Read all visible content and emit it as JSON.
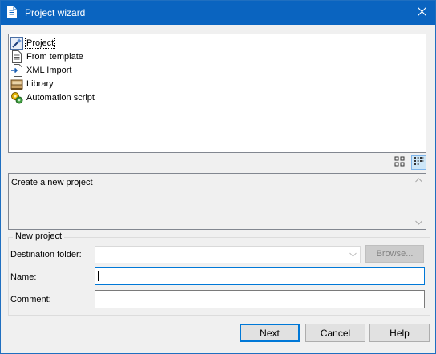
{
  "window": {
    "title": "Project wizard"
  },
  "templates": [
    {
      "label": "Project",
      "icon": "project-wand-icon",
      "selected": true
    },
    {
      "label": "From template",
      "icon": "document-icon",
      "selected": false
    },
    {
      "label": "XML Import",
      "icon": "xml-import-icon",
      "selected": false
    },
    {
      "label": "Library",
      "icon": "library-icon",
      "selected": false
    },
    {
      "label": "Automation script",
      "icon": "automation-script-icon",
      "selected": false
    }
  ],
  "view_buttons": [
    {
      "icon": "large-icons-view-icon",
      "active": false
    },
    {
      "icon": "list-view-icon",
      "active": true
    }
  ],
  "description": {
    "text": "Create a new project"
  },
  "new_project": {
    "legend": "New project",
    "destination_label": "Destination folder:",
    "destination_value": "",
    "browse_label": "Browse...",
    "name_label": "Name:",
    "name_value": "",
    "comment_label": "Comment:",
    "comment_value": ""
  },
  "buttons": {
    "next": "Next",
    "cancel": "Cancel",
    "help": "Help"
  },
  "colors": {
    "titlebar": "#0a64c0",
    "focus": "#0078d7",
    "dialog_bg": "#f0f0f0"
  }
}
